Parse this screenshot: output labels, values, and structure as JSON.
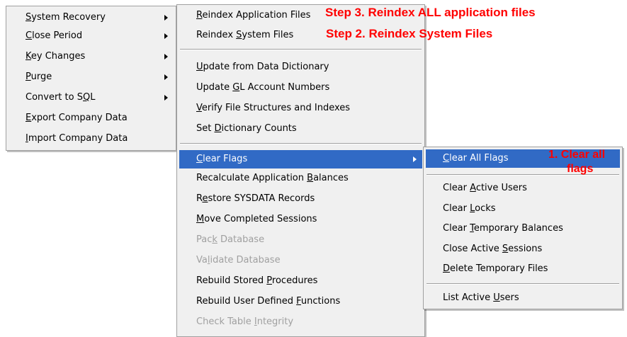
{
  "main_menu": [
    {
      "pre": "",
      "key": "S",
      "post": "ystem Recovery",
      "submenu": true,
      "selected": true
    },
    {
      "pre": "",
      "key": "C",
      "post": "lose Period",
      "submenu": true
    },
    {
      "pre": "",
      "key": "K",
      "post": "ey Changes",
      "submenu": true
    },
    {
      "pre": "",
      "key": "P",
      "post": "urge",
      "submenu": true
    },
    {
      "pre": "Convert to S",
      "key": "Q",
      "post": "L",
      "submenu": true
    },
    {
      "pre": "",
      "key": "E",
      "post": "xport Company Data"
    },
    {
      "pre": "",
      "key": "I",
      "post": "mport Company Data"
    }
  ],
  "recovery_menu": [
    {
      "pre": "",
      "key": "R",
      "post": "eindex Application Files"
    },
    {
      "pre": "Reindex ",
      "key": "S",
      "post": "ystem Files"
    },
    {
      "pre": "",
      "key": "U",
      "post": "pdate from Data Dictionary"
    },
    {
      "pre": "Update ",
      "key": "G",
      "post": "L Account Numbers"
    },
    {
      "pre": "",
      "key": "V",
      "post": "erify File Structures and Indexes"
    },
    {
      "pre": "Set ",
      "key": "D",
      "post": "ictionary Counts"
    },
    {
      "pre": "",
      "key": "C",
      "post": "lear Flags",
      "submenu": true,
      "selected": true
    },
    {
      "pre": "Recalculate Application ",
      "key": "B",
      "post": "alances"
    },
    {
      "pre": "R",
      "key": "e",
      "post": "store SYSDATA Records"
    },
    {
      "pre": "",
      "key": "M",
      "post": "ove Completed Sessions"
    },
    {
      "pre": "Pac",
      "key": "k",
      "post": " Database",
      "disabled": true
    },
    {
      "pre": "Va",
      "key": "l",
      "post": "idate Database",
      "disabled": true
    },
    {
      "pre": "Rebuild Stored ",
      "key": "P",
      "post": "rocedures"
    },
    {
      "pre": "Rebuild User Defined ",
      "key": "F",
      "post": "unctions"
    },
    {
      "pre": "Check Table ",
      "key": "I",
      "post": "ntegrity",
      "disabled": true
    }
  ],
  "flags_menu": [
    {
      "pre": "",
      "key": "C",
      "post": "lear All Flags",
      "selected": true
    },
    {
      "pre": "Clear ",
      "key": "A",
      "post": "ctive Users"
    },
    {
      "pre": "Clear ",
      "key": "L",
      "post": "ocks"
    },
    {
      "pre": "Clear ",
      "key": "T",
      "post": "emporary Balances"
    },
    {
      "pre": "Close Active ",
      "key": "S",
      "post": "essions"
    },
    {
      "pre": "",
      "key": "D",
      "post": "elete Temporary Files"
    },
    {
      "pre": "List Active ",
      "key": "U",
      "post": "sers"
    }
  ],
  "annotations": {
    "step3": "Step 3. Reindex ALL application files",
    "step2": "Step 2. Reindex System Files",
    "step1_line1": "1. Clear all",
    "step1_line2": "flags",
    "color": "#ff0000"
  },
  "colors": {
    "menu_bg": "#f0f0f0",
    "highlight": "#316ac5",
    "disabled_text": "#a0a0a0"
  }
}
